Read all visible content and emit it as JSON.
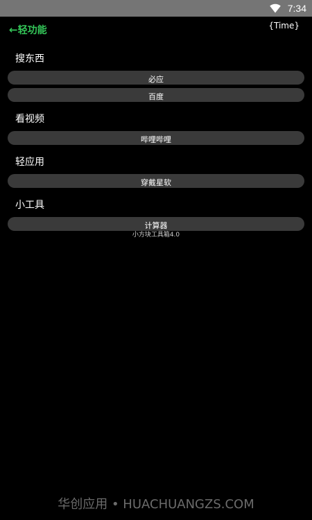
{
  "status_bar": {
    "time": "7:34",
    "wifi_icon": "wifi-icon"
  },
  "header": {
    "back_arrow": "←",
    "title": "轻功能",
    "time_placeholder": "{Time}"
  },
  "sections": [
    {
      "title": "搜东西",
      "buttons": [
        "必应",
        "百度"
      ]
    },
    {
      "title": "看视频",
      "buttons": [
        "哔哩哔哩"
      ]
    },
    {
      "title": "轻应用",
      "buttons": [
        "穿戴星软"
      ]
    },
    {
      "title": "小工具",
      "buttons": [
        "计算器"
      ]
    }
  ],
  "version": "小方块工具箱4.0",
  "watermark": "华创应用 • HUACHUANGZS.COM",
  "colors": {
    "background": "#000000",
    "status_bar": "#757575",
    "accent": "#34c759",
    "pill": "#3a3a3a"
  }
}
